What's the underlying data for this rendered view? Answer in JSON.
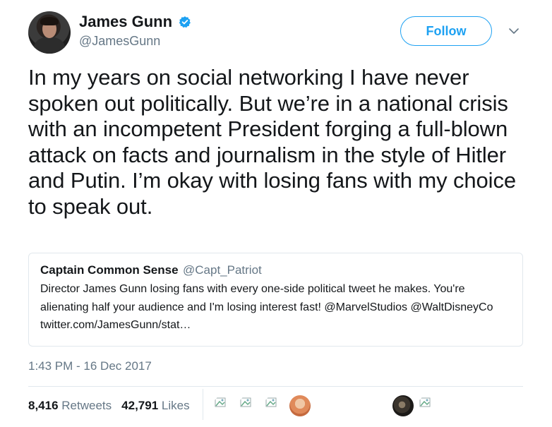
{
  "author": {
    "display_name": "James Gunn",
    "handle": "@JamesGunn",
    "verified_icon": "verified-badge-icon"
  },
  "actions": {
    "follow_label": "Follow",
    "more_icon": "chevron-down-icon"
  },
  "tweet": {
    "text": "In my years on social networking I have never spoken out politically. But we’re in a national crisis with an incompetent President forging a full-blown attack on facts and journalism in the style of Hitler and Putin. I’m okay with losing fans with my choice to speak out.",
    "timestamp": "1:43 PM - 16 Dec 2017"
  },
  "quoted_tweet": {
    "display_name": "Captain Common Sense",
    "handle": "@Capt_Patriot",
    "text": "Director James Gunn losing fans with every one-side political tweet he makes. You're alienating half your audience and I'm losing interest fast!  @MarvelStudios @WaltDisneyCo twitter.com/JamesGunn/stat…"
  },
  "stats": {
    "retweets_count": "8,416",
    "retweets_label": "Retweets",
    "likes_count": "42,791",
    "likes_label": "Likes"
  },
  "colors": {
    "accent": "#1da1f2",
    "secondary_text": "#657786",
    "border": "#e1e8ed"
  }
}
